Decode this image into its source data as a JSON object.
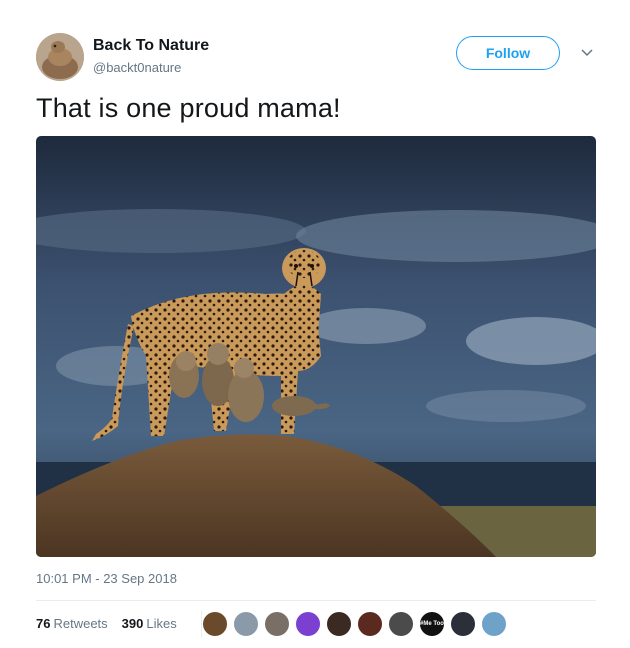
{
  "author": {
    "name": "Back To Nature",
    "handle": "@backt0nature"
  },
  "follow_label": "Follow",
  "tweet_text": "That is one proud mama!",
  "timestamp": "10:01 PM - 23 Sep 2018",
  "stats": {
    "retweets_count": "76",
    "retweets_label": "Retweets",
    "likes_count": "390",
    "likes_label": "Likes"
  },
  "likers": [
    {
      "icon": "liker-avatar",
      "color": "#6b4a2b"
    },
    {
      "icon": "liker-avatar",
      "color": "#8a9aa8"
    },
    {
      "icon": "liker-avatar",
      "color": "#7a6f66"
    },
    {
      "icon": "liker-avatar",
      "color": "#7b3fd1"
    },
    {
      "icon": "liker-avatar",
      "color": "#3b2a22"
    },
    {
      "icon": "liker-avatar",
      "color": "#5a2a1e"
    },
    {
      "icon": "liker-avatar",
      "color": "#4b4b4b"
    },
    {
      "icon": "liker-avatar",
      "color": "#111111",
      "text": "#Me Too"
    },
    {
      "icon": "liker-avatar",
      "color": "#2a2f3a"
    },
    {
      "icon": "liker-avatar",
      "color": "#6fa2c9"
    }
  ],
  "colors": {
    "accent": "#1da1f2",
    "secondary_text": "#657786"
  }
}
